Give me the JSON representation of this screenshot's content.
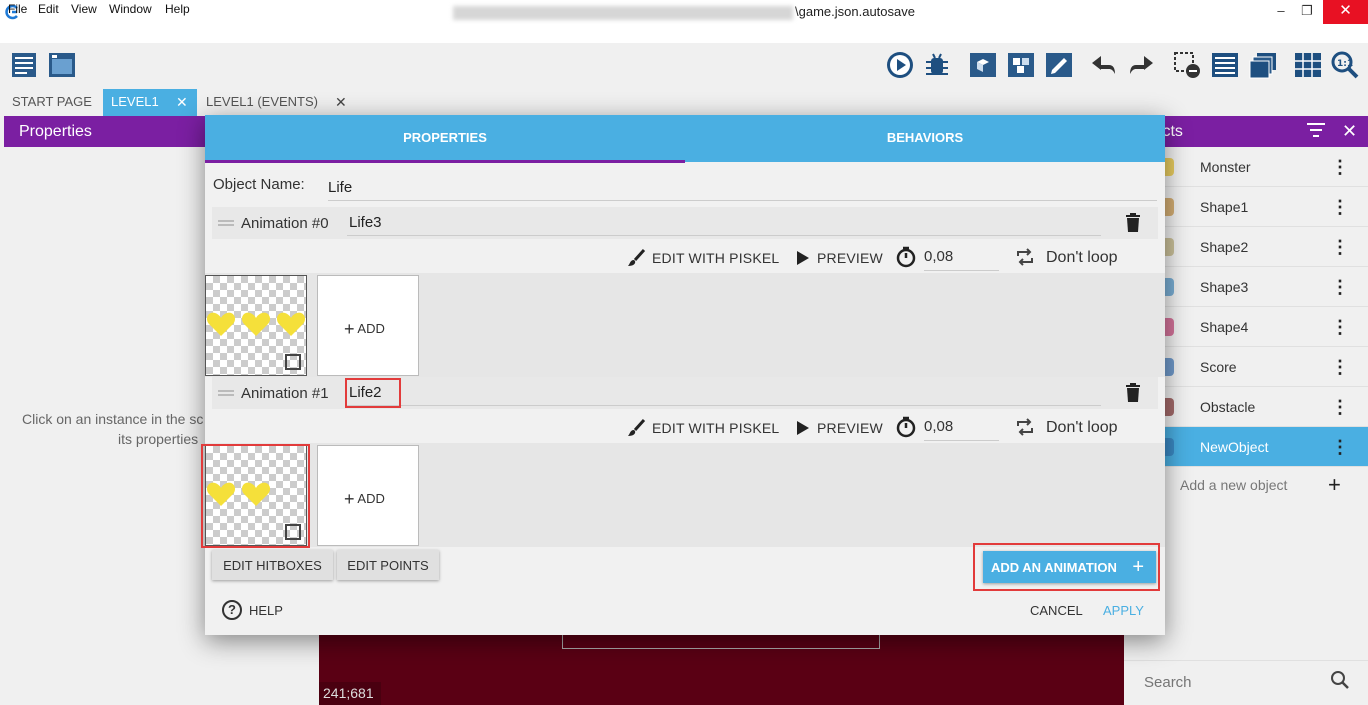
{
  "window": {
    "title_suffix": "\\game.json.autosave",
    "min": "–",
    "max": "❐",
    "close": "✕"
  },
  "menu": [
    "File",
    "Edit",
    "View",
    "Window",
    "Help"
  ],
  "tabs": [
    {
      "label": "START PAGE"
    },
    {
      "label": "LEVEL1"
    },
    {
      "label": "LEVEL1 (EVENTS)"
    }
  ],
  "tab_close": "✕",
  "left_panel": {
    "title": "Properties",
    "hint_line1": "Click on an instance in the sc",
    "hint_line2": "its properties"
  },
  "canvas": {
    "coords": "241;681"
  },
  "right_panel": {
    "title": "jects",
    "objects": [
      {
        "label": "Monster",
        "color": "#e3b400"
      },
      {
        "label": "Shape1",
        "color": "#c08020"
      },
      {
        "label": "Shape2",
        "color": "#b0a060"
      },
      {
        "label": "Shape3",
        "color": "#2a80c0"
      },
      {
        "label": "Shape4",
        "color": "#c02060"
      },
      {
        "label": "Score",
        "color": "#1a60b0"
      },
      {
        "label": "Obstacle",
        "color": "#701010"
      },
      {
        "label": "NewObject",
        "color": "#3070b0"
      }
    ],
    "add_label": "Add a new object",
    "search_placeholder": "Search"
  },
  "dialog": {
    "tab_properties": "PROPERTIES",
    "tab_behaviors": "BEHAVIORS",
    "object_name_label": "Object Name:",
    "object_name_value": "Life",
    "animations": [
      {
        "label": "Animation #0",
        "name": "Life3",
        "duration": "0,08",
        "loop": "Don't loop",
        "hearts": 3
      },
      {
        "label": "Animation #1",
        "name": "Life2",
        "duration": "0,08",
        "loop": "Don't loop",
        "hearts": 2
      }
    ],
    "edit_piskel": "EDIT WITH PISKEL",
    "preview": "PREVIEW",
    "add_frame": "ADD",
    "edit_hitboxes": "EDIT HITBOXES",
    "edit_points": "EDIT POINTS",
    "add_animation": "ADD AN ANIMATION",
    "help": "HELP",
    "cancel": "CANCEL",
    "apply": "APPLY"
  },
  "colors": {
    "accent_blue": "#4aafe2",
    "panel_purple": "#7b1fa2",
    "highlight_red": "#e23b3b",
    "heart_yellow": "#f5e03a"
  }
}
